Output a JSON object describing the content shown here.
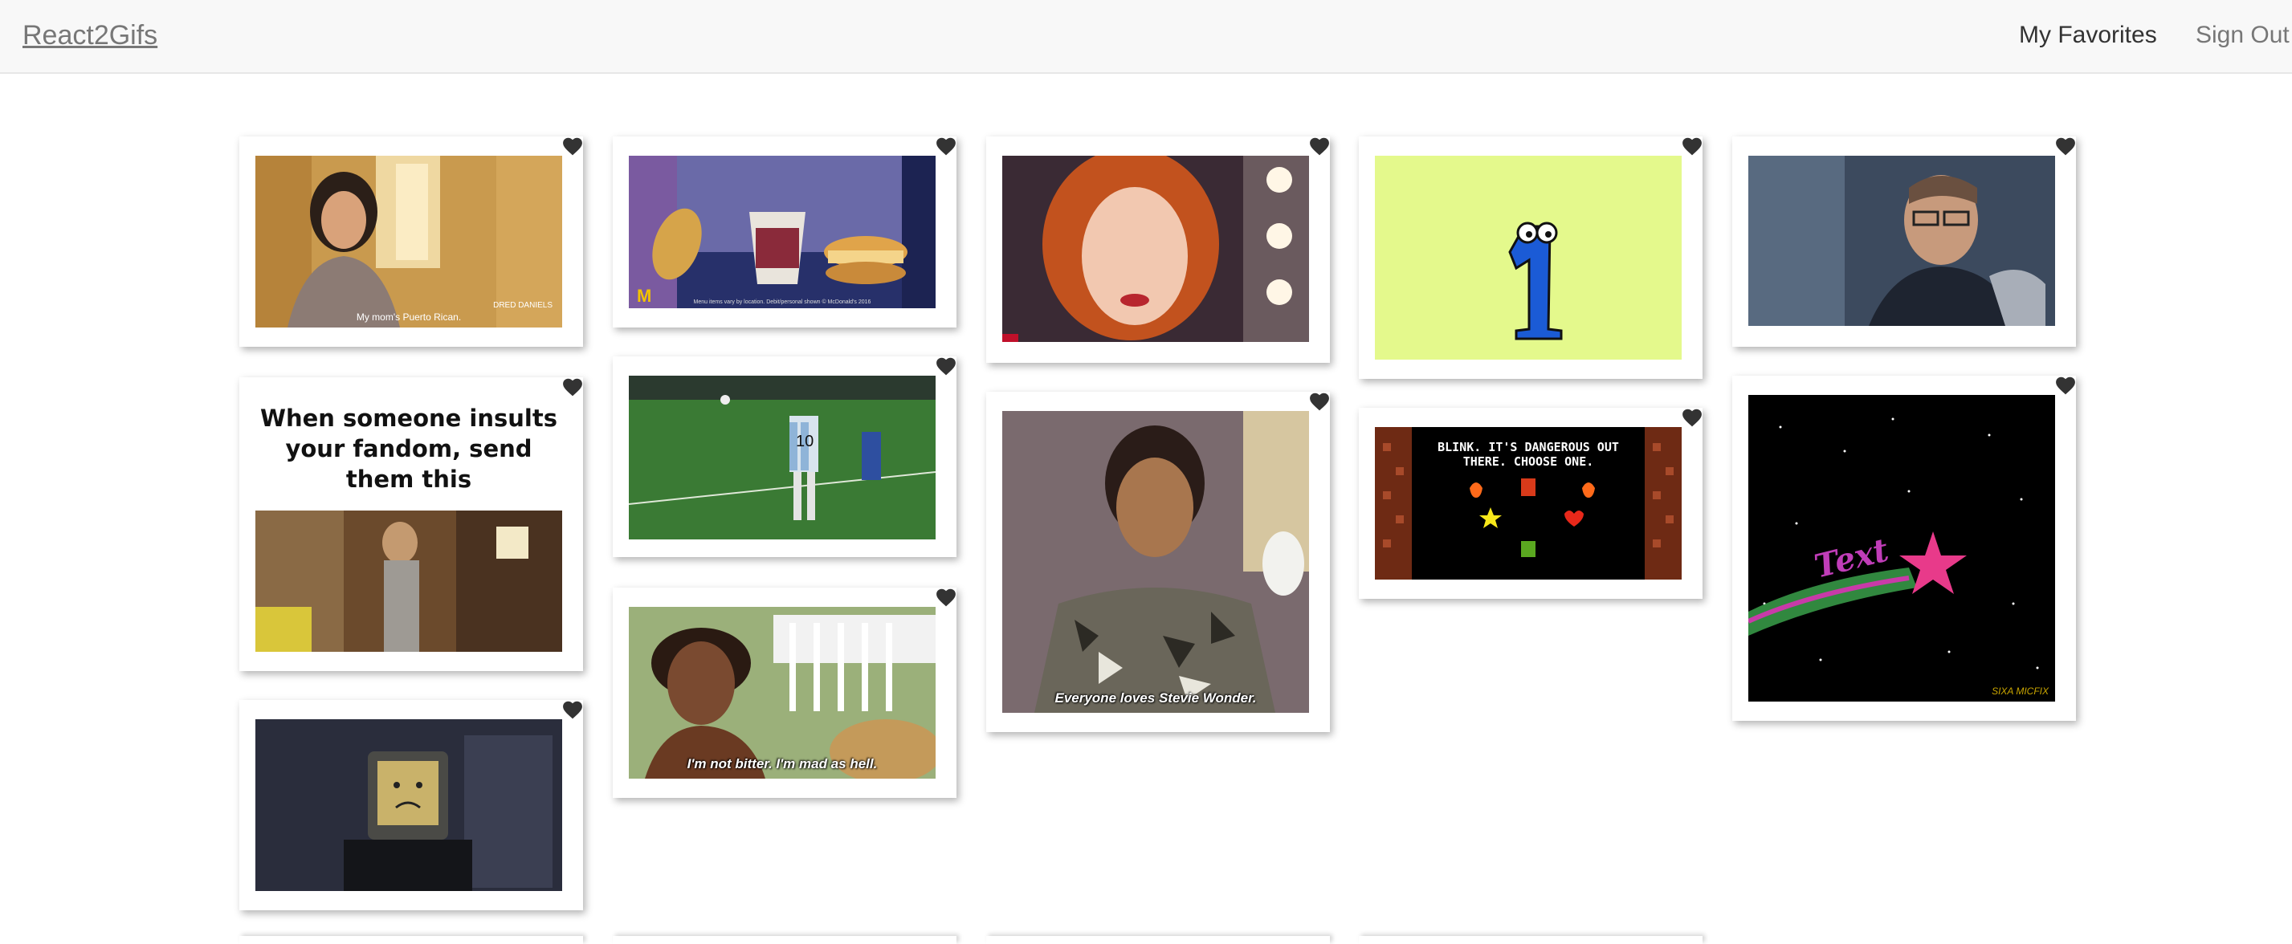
{
  "navbar": {
    "brand": "React2Gifs",
    "links": {
      "favorites": "My Favorites",
      "sign_out": "Sign Out"
    }
  },
  "icons": {
    "favorite": "heart-icon"
  },
  "colors": {
    "heart": "#333333",
    "navbar_bg": "#f8f8f8",
    "brand": "#777777"
  },
  "gifs": [
    {
      "id": "woman-hallway",
      "subtitle_small": "DRED DANIELS",
      "subtitle": "My mom's Puerto Rican."
    },
    {
      "id": "fandom-meme",
      "title": "When someone insults your fandom, send them this"
    },
    {
      "id": "sad-computer"
    },
    {
      "id": "mcdonalds-ad",
      "fine_print": "Menu items vary by location. Debit/personal shown © McDonald's 2016"
    },
    {
      "id": "soccer-player",
      "jersey": "10"
    },
    {
      "id": "not-bitter",
      "caption": "I'm not bitter. I'm mad as hell."
    },
    {
      "id": "red-hair-woman"
    },
    {
      "id": "stevie-wonder",
      "caption": "Everyone loves Stevie Wonder."
    },
    {
      "id": "blue-number-one"
    },
    {
      "id": "zelda-game",
      "text": "BLINK. IT'S DANGEROUS OUT THERE. CHOOSE ONE."
    },
    {
      "id": "man-glasses"
    },
    {
      "id": "text-star",
      "text": "Text",
      "watermark": "SIXA MICFIX"
    }
  ]
}
